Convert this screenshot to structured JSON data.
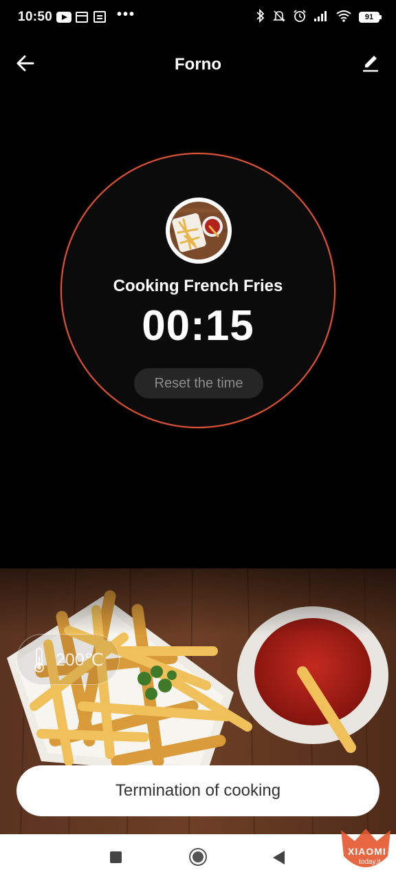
{
  "status_bar": {
    "time": "10:50",
    "battery": "91"
  },
  "header": {
    "title": "Forno"
  },
  "cooking": {
    "label": "Cooking French Fries",
    "timer": "00:15",
    "reset_label": "Reset the time"
  },
  "temperature": {
    "value": "200℃"
  },
  "actions": {
    "terminate_label": "Termination of cooking"
  },
  "watermark": {
    "brand": "XIAOMI",
    "site": "today.it"
  },
  "colors": {
    "accent_ring": "#e0553a",
    "background": "#000000",
    "reset_button": "#262626"
  },
  "icons": {
    "back": "arrow-left-icon",
    "edit": "pencil-icon",
    "temperature": "thermometer-icon"
  }
}
